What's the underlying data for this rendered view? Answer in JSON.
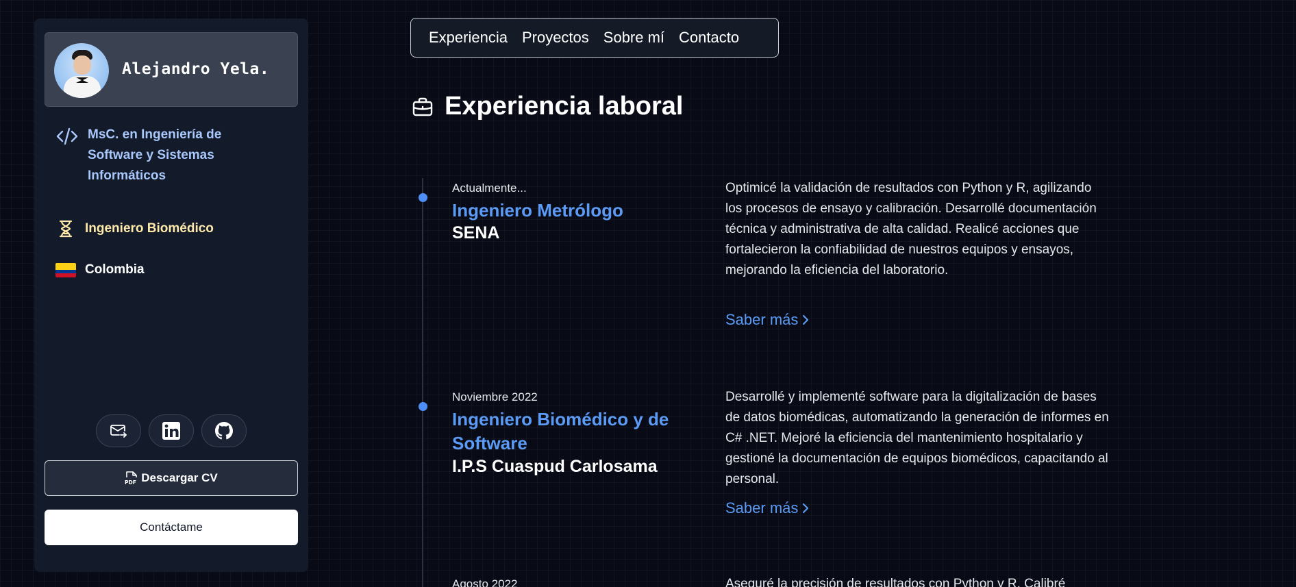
{
  "sidebar": {
    "profile": {
      "name": "Alejandro Yela."
    },
    "degree": "MsC. en Ingeniería de Software y Sistemas Informáticos",
    "job": "Ingeniero Biomédico",
    "country": "Colombia",
    "buttons": {
      "download_cv": "Descargar CV",
      "contact": "Contáctame"
    },
    "icons": [
      "code-icon",
      "hourglass-icon",
      "colombia-flag-icon",
      "mail-icon",
      "linkedin-icon",
      "github-icon",
      "pdf-icon"
    ]
  },
  "nav": {
    "items": [
      {
        "label": "Experiencia"
      },
      {
        "label": "Proyectos"
      },
      {
        "label": "Sobre mí"
      },
      {
        "label": "Contacto"
      }
    ]
  },
  "section": {
    "title": "Experiencia laboral",
    "icon": "briefcase-icon"
  },
  "experience": [
    {
      "date": "Actualmente...",
      "role": "Ingeniero Metrólogo",
      "company": "SENA",
      "description": "Optimicé la validación de resultados con Python y R, agilizando los procesos de ensayo y calibración. Desarrollé documentación técnica y administrativa de alta calidad. Realicé acciones que fortalecieron la confiabilidad de nuestros equipos y ensayos, mejorando la eficiencia del laboratorio.",
      "more": "Saber más"
    },
    {
      "date": "Noviembre 2022",
      "role": "Ingeniero Biomédico y de Software",
      "company": "I.P.S Cuaspud Carlosama",
      "description": "Desarrollé y implementé software para la digitalización de bases de datos biomédicas, automatizando la generación de informes en C# .NET. Mejoré la eficiencia del mantenimiento hospitalario y gestioné la documentación de equipos biomédicos, capacitando al personal.",
      "more": "Saber más"
    },
    {
      "date": "Agosto 2022",
      "description": "Aseguré la precisión de resultados con Python y R. Calibré"
    }
  ],
  "colors": {
    "background": "#080b16",
    "sidebar": "#131a2a",
    "accent_blue": "#5b9bf5",
    "degree_text": "#a8c7fa",
    "job_text": "#fde9a9"
  }
}
